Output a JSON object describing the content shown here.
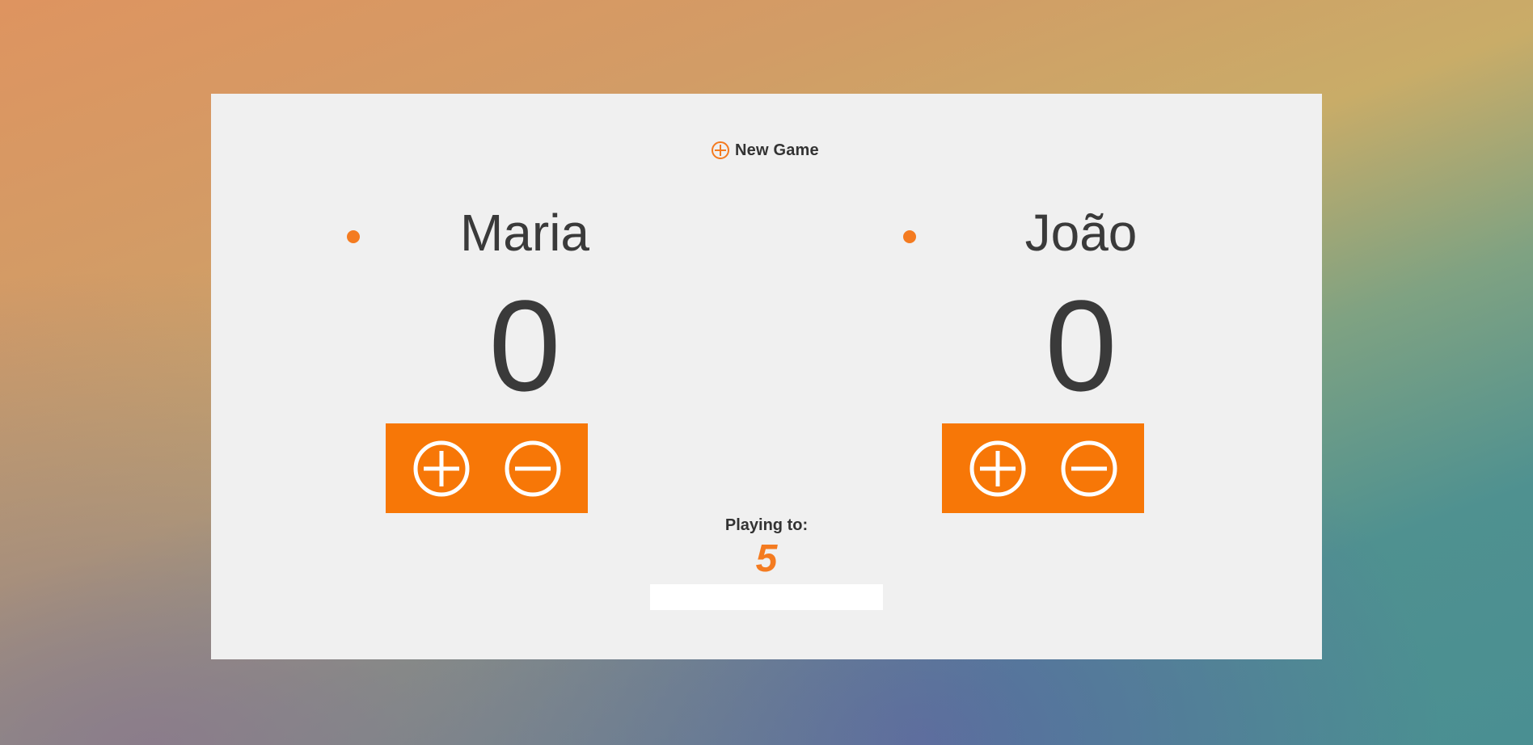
{
  "header": {
    "new_game_label": "New Game",
    "new_game_icon": "plus-circle-icon"
  },
  "players": [
    {
      "name": "Maria",
      "score": "0",
      "increment_icon": "plus-circle-icon",
      "decrement_icon": "minus-circle-icon"
    },
    {
      "name": "João",
      "score": "0",
      "increment_icon": "plus-circle-icon",
      "decrement_icon": "minus-circle-icon"
    }
  ],
  "target": {
    "label": "Playing to:",
    "value": "5",
    "input_value": ""
  },
  "colors": {
    "accent": "#f47b20",
    "button_bg": "#f77707",
    "panel_bg": "#f0f0f0",
    "text": "#3a3a3a"
  }
}
